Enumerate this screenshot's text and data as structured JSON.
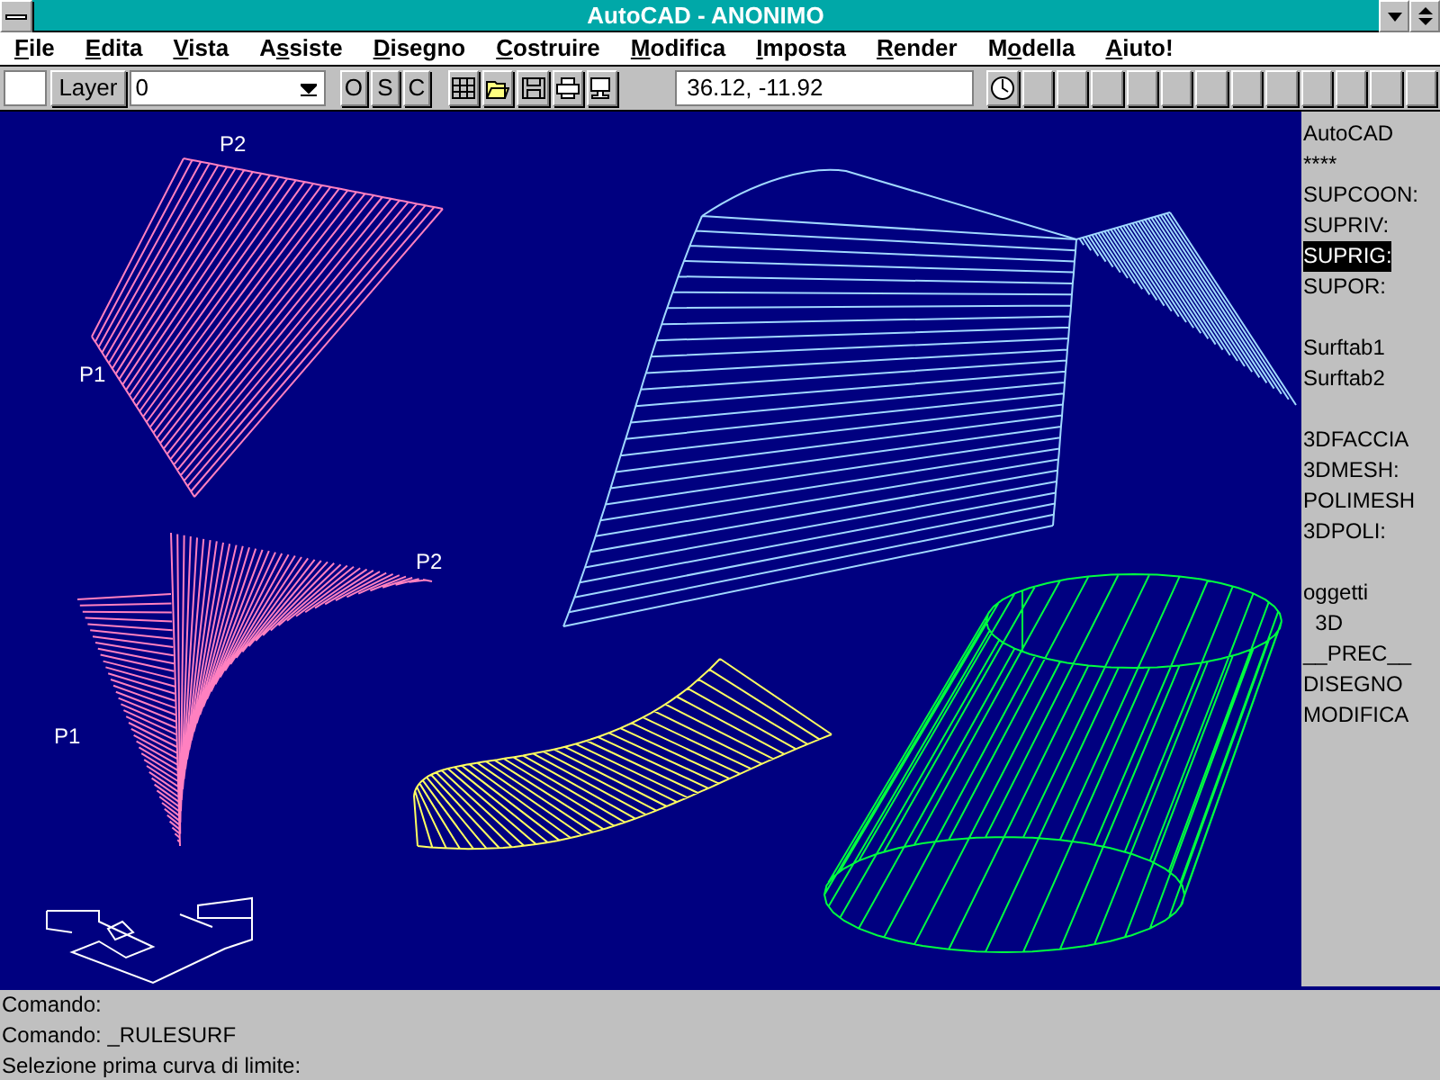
{
  "window": {
    "title": "AutoCAD - ANONIMO"
  },
  "menu": [
    {
      "key": "F",
      "post": "ile"
    },
    {
      "key": "E",
      "post": "dita"
    },
    {
      "key": "V",
      "post": "ista"
    },
    {
      "pre": "A",
      "key": "s",
      "post": "siste"
    },
    {
      "key": "D",
      "post": "isegno"
    },
    {
      "key": "C",
      "post": "ostruire"
    },
    {
      "key": "M",
      "post": "odifica"
    },
    {
      "key": "I",
      "post": "mposta"
    },
    {
      "key": "R",
      "post": "ender"
    },
    {
      "pre": "M",
      "key": "o",
      "post": "della"
    },
    {
      "key": "A",
      "post": "iuto!"
    }
  ],
  "toolbar": {
    "layer_button": "Layer",
    "layer_value": "0",
    "snap_buttons": [
      "O",
      "S",
      "C"
    ],
    "coordinates": "36.12, -11.92"
  },
  "canvas": {
    "labels": [
      "P2",
      "P1",
      "P2",
      "P1"
    ]
  },
  "side_menu": [
    [
      {
        "label": "AutoCAD",
        "selected": false
      },
      {
        "label": "****",
        "selected": false
      },
      {
        "label": "SUPCOON:",
        "selected": false
      },
      {
        "label": "SUPRIV:",
        "selected": false
      },
      {
        "label": "SUPRIG:",
        "selected": true
      },
      {
        "label": "SUPOR:",
        "selected": false
      }
    ],
    [
      {
        "label": "Surftab1",
        "selected": false
      },
      {
        "label": "Surftab2",
        "selected": false
      }
    ],
    [
      {
        "label": "3DFACCIA",
        "selected": false
      },
      {
        "label": "3DMESH:",
        "selected": false
      },
      {
        "label": "POLIMESH",
        "selected": false
      },
      {
        "label": "3DPOLI:",
        "selected": false
      }
    ],
    [
      {
        "label": "oggetti",
        "selected": false
      },
      {
        "label": "  3D",
        "selected": false
      },
      {
        "label": "__PREC__",
        "selected": false
      },
      {
        "label": "DISEGNO",
        "selected": false
      },
      {
        "label": "MODIFICA",
        "selected": false
      }
    ]
  ],
  "command_lines": [
    "Comando:",
    "Comando: _RULESURF",
    "Selezione prima curva di limite:"
  ]
}
